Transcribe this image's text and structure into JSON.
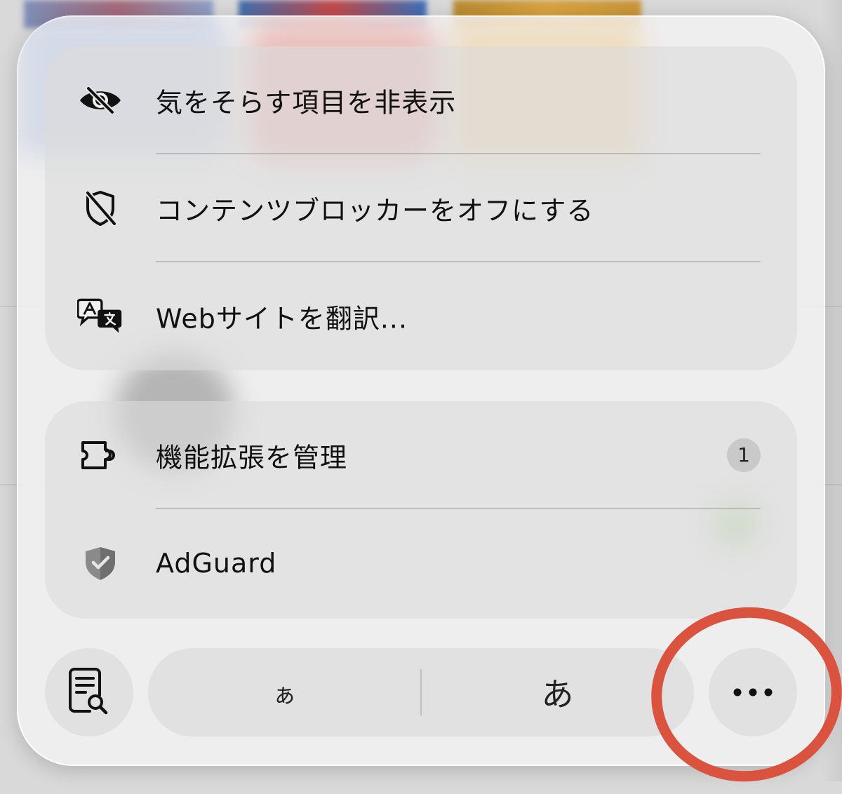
{
  "menu": {
    "primary_items": [
      {
        "icon": "eye-slash-icon",
        "label": "気をそらす項目を非表示"
      },
      {
        "icon": "shield-slash-icon",
        "label": "コンテンツブロッカーをオフにする"
      },
      {
        "icon": "translate-icon",
        "label": "Webサイトを翻訳..."
      }
    ],
    "extension_items": [
      {
        "icon": "puzzle-piece-icon",
        "label": "機能拡張を管理",
        "badge": "1"
      },
      {
        "icon": "adguard-shield-icon",
        "label": "AdGuard"
      }
    ],
    "bottom_bar": {
      "reader_icon": "document-magnifier-icon",
      "font_smaller_label": "ぁ",
      "font_larger_label": "あ",
      "more_icon": "ellipsis-icon"
    }
  },
  "colors": {
    "annotation_red": "#d9533f",
    "icon_dark": "#111111",
    "adguard_gray": "#8a8a8a"
  }
}
